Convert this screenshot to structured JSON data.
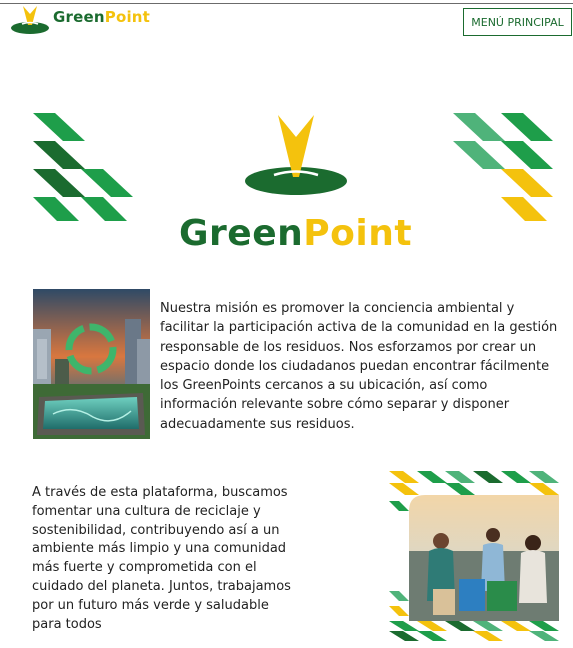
{
  "header": {
    "brand": {
      "green": "Green",
      "yellow": "Point"
    },
    "menu_label": "MENÚ PRINCIPAL"
  },
  "hero": {
    "title": {
      "green": "Green",
      "yellow": "Point"
    }
  },
  "sections": [
    {
      "text": "Nuestra misión es promover la conciencia ambiental y facilitar la participación activa de la comunidad en la gestión responsable de los residuos. Nos esforzamos por crear un espacio donde los ciudadanos puedan encontrar fácilmente los GreenPoints cercanos a su ubicación, así como información relevante sobre cómo separar y disponer adecuadamente sus residuos."
    },
    {
      "text": "A través de esta plataforma, buscamos fomentar una cultura de reciclaje y sostenibilidad, contribuyendo así a un ambiente más limpio y una comunidad más fuerte y comprometida con el cuidado del planeta. Juntos, trabajamos por un futuro más verde y saludable para todos"
    }
  ],
  "colors": {
    "brand_green": "#1b6b2f",
    "brand_yellow": "#f4c20d",
    "accent_green": "#1e9e4a",
    "light_green": "#4fb37a"
  }
}
